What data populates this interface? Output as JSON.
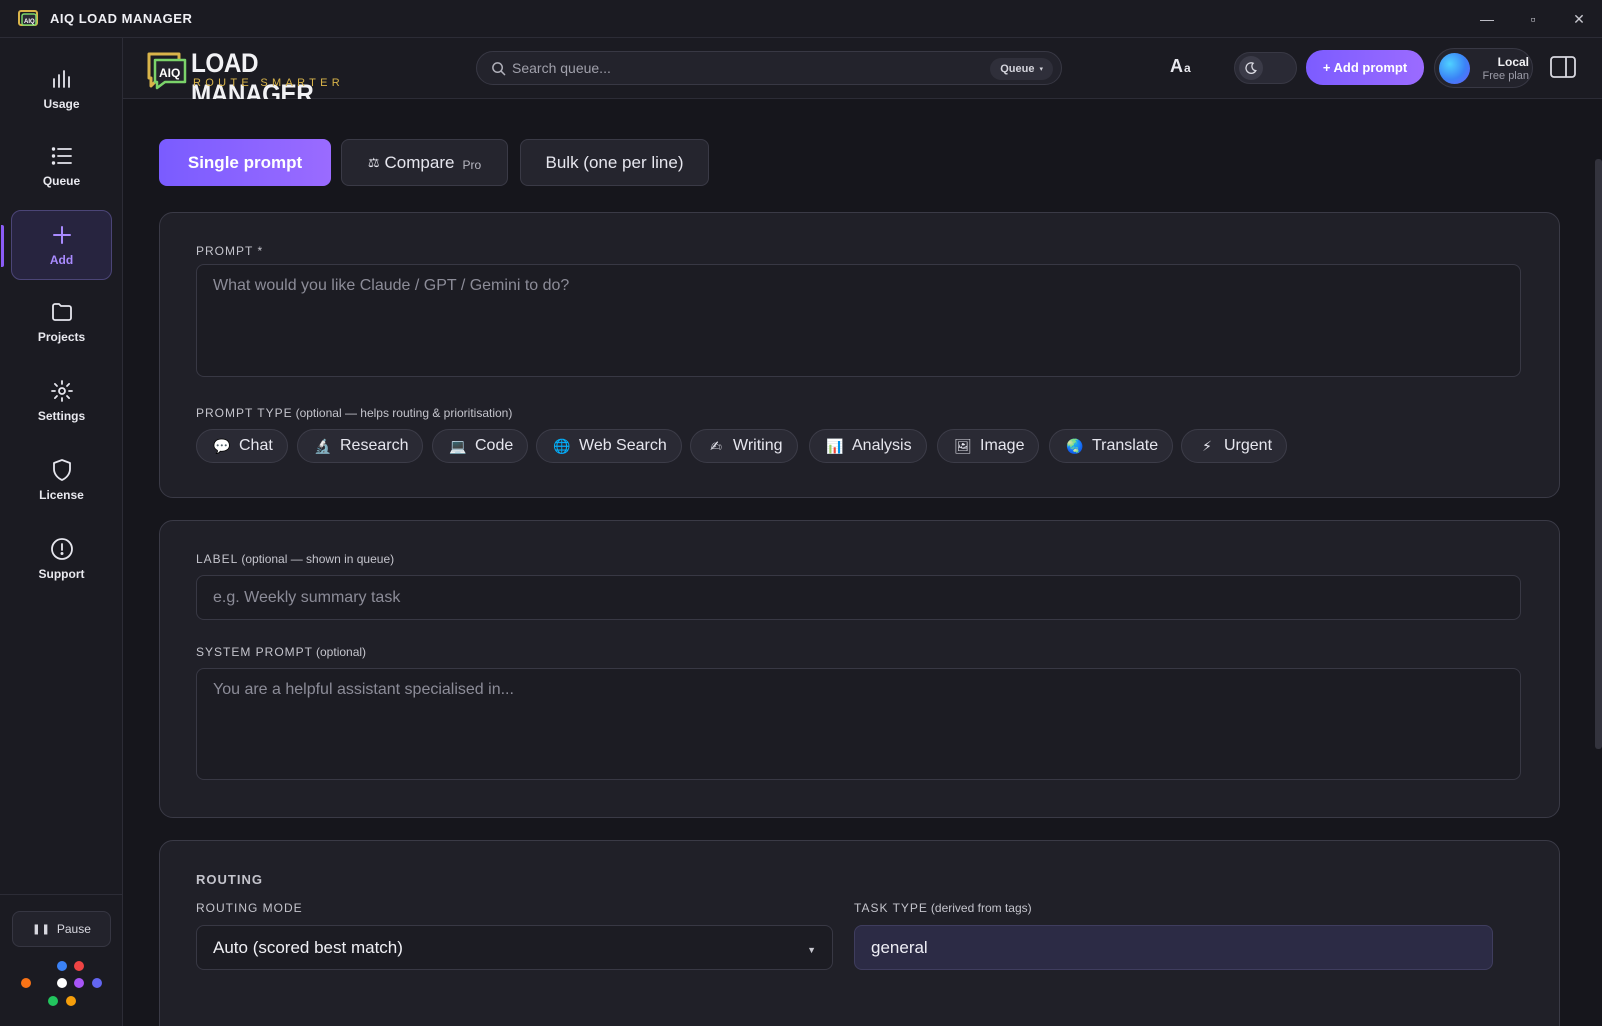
{
  "window": {
    "title": "AIQ LOAD MANAGER",
    "controls": [
      "—",
      "▫",
      "✕"
    ]
  },
  "sidebar": {
    "items": [
      {
        "label": "Usage",
        "icon": "bar-chart-icon"
      },
      {
        "label": "Queue",
        "icon": "list-icon"
      },
      {
        "label": "Add",
        "icon": "plus-icon",
        "active": true
      },
      {
        "label": "Projects",
        "icon": "folder-icon"
      },
      {
        "label": "Settings",
        "icon": "gear-icon"
      },
      {
        "label": "License",
        "icon": "shield-icon"
      },
      {
        "label": "Support",
        "icon": "alert-circle-icon"
      }
    ],
    "pause_label": "Pause",
    "status_dot_colors": [
      "#3b82f6",
      "#ef4444",
      "#f97316",
      "#ffffff",
      "#a855f7",
      "#6366f1",
      "#22c55e",
      "#f59e0b"
    ]
  },
  "header": {
    "brand_badge": "AIQ",
    "brand_main": "LOAD MANAGER",
    "brand_sub": "ROUTE SMARTER",
    "search_placeholder": "Search queue...",
    "search_scope": "Queue",
    "font_size_big": "A",
    "font_size_small": "a",
    "add_prompt_label": "+ Add prompt",
    "user_name": "Local",
    "user_plan": "Free plan"
  },
  "mode_tabs": [
    {
      "label": "Single prompt",
      "active": true
    },
    {
      "label": "Compare",
      "badge": "Pro",
      "icon": "⚖"
    },
    {
      "label": "Bulk (one per line)"
    }
  ],
  "prompt_card": {
    "prompt_label": "PROMPT *",
    "prompt_placeholder": "What would you like Claude / GPT / Gemini to do?",
    "type_label": "PROMPT TYPE",
    "type_hint": "(optional — helps routing & prioritisation)",
    "types": [
      {
        "label": "Chat",
        "emoji": "💬"
      },
      {
        "label": "Research",
        "emoji": "🔬"
      },
      {
        "label": "Code",
        "emoji": "💻"
      },
      {
        "label": "Web Search",
        "emoji": "🌐"
      },
      {
        "label": "Writing",
        "emoji": "✍"
      },
      {
        "label": "Analysis",
        "emoji": "📊"
      },
      {
        "label": "Image",
        "emoji": "🖼"
      },
      {
        "label": "Translate",
        "emoji": "🌏"
      },
      {
        "label": "Urgent",
        "emoji": "⚡"
      }
    ]
  },
  "label_card": {
    "label_label": "LABEL",
    "label_hint": "(optional — shown in queue)",
    "label_placeholder": "e.g. Weekly summary task",
    "system_label": "SYSTEM PROMPT",
    "system_hint": "(optional)",
    "system_placeholder": "You are a helpful assistant specialised in..."
  },
  "routing_card": {
    "title": "ROUTING",
    "mode_label": "ROUTING MODE",
    "mode_value": "Auto (scored best match)",
    "task_label": "TASK TYPE",
    "task_hint": "(derived from tags)",
    "task_value": "general"
  },
  "colors": {
    "accent": "#8b5cf6",
    "background": "#16161c",
    "card": "#202028"
  }
}
